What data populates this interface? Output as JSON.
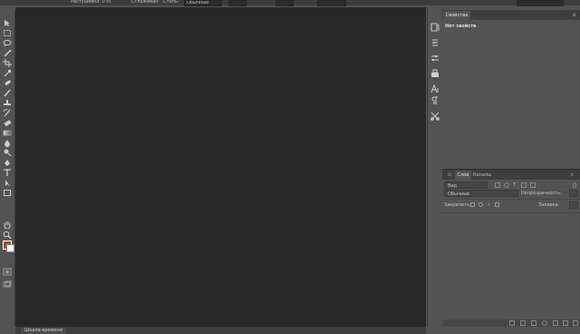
{
  "options_bar": {
    "items": [
      "Растушевка: 0 пикс",
      "Сглаживание",
      "Стиль:",
      "Обычный"
    ]
  },
  "canvas": {
    "background": "#282828",
    "status_label": "Шкала времени"
  },
  "colors": {
    "foreground": "#a0512d",
    "background": "#ffffff"
  },
  "toolbar": {
    "tools": [
      "move-icon",
      "marquee-icon",
      "lasso-icon",
      "quick-select-icon",
      "crop-icon",
      "eyedropper-icon",
      "healing-icon",
      "brush-icon",
      "stamp-icon",
      "history-brush-icon",
      "eraser-icon",
      "gradient-icon",
      "blur-icon",
      "dodge-icon",
      "pen-icon",
      "type-icon",
      "path-select-icon",
      "shape-icon",
      "hand-icon",
      "zoom-icon"
    ]
  },
  "dock": {
    "buttons": [
      "history-icon",
      "properties-icon",
      "adjustments-icon",
      "libraries-icon",
      "character-icon",
      "paragraph-icon",
      "tools-icon"
    ]
  },
  "properties": {
    "tab": "Свойства",
    "empty_text": "Нет свойств"
  },
  "layers": {
    "tabs": [
      "Слои",
      "Каналы"
    ],
    "filter_label": "Вид",
    "blend_mode": "Обычные",
    "opacity_label": "Непрозрачность:",
    "lock_label": "Закрепить:",
    "fill_label": "Заливка:"
  }
}
